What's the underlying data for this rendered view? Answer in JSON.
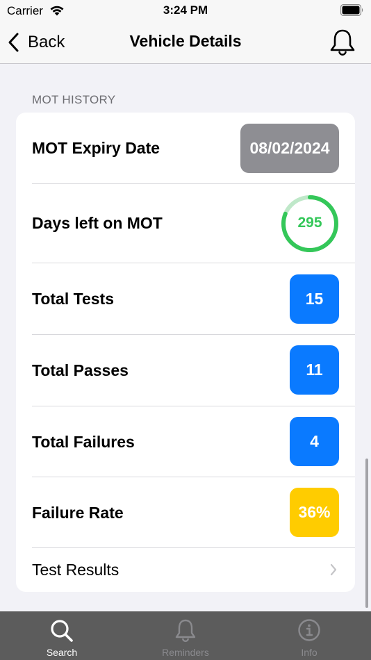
{
  "status_bar": {
    "carrier": "Carrier",
    "time": "3:24 PM"
  },
  "nav": {
    "back_label": "Back",
    "title": "Vehicle Details"
  },
  "section": {
    "header": "MOT HISTORY"
  },
  "rows": {
    "expiry": {
      "label": "MOT Expiry Date",
      "value": "08/02/2024"
    },
    "days_left": {
      "label": "Days left on MOT",
      "value": "295",
      "progress": 0.81
    },
    "total_tests": {
      "label": "Total Tests",
      "value": "15"
    },
    "total_passes": {
      "label": "Total Passes",
      "value": "11"
    },
    "total_failures": {
      "label": "Total Failures",
      "value": "4"
    },
    "failure_rate": {
      "label": "Failure Rate",
      "value": "36%"
    },
    "test_results": {
      "label": "Test Results"
    }
  },
  "tabs": [
    {
      "label": "Search",
      "icon": "magnifier-icon",
      "active": true
    },
    {
      "label": "Reminders",
      "icon": "bell-icon",
      "active": false
    },
    {
      "label": "Info",
      "icon": "info-circle-icon",
      "active": false
    }
  ],
  "colors": {
    "blue": "#0a7aff",
    "gray_pill": "#8e8e93",
    "yellow": "#ffcc00",
    "green": "#34c759",
    "green_light": "#bfe8c9",
    "tab_active": "#ffffff",
    "tab_inactive": "#8a8a8e"
  }
}
